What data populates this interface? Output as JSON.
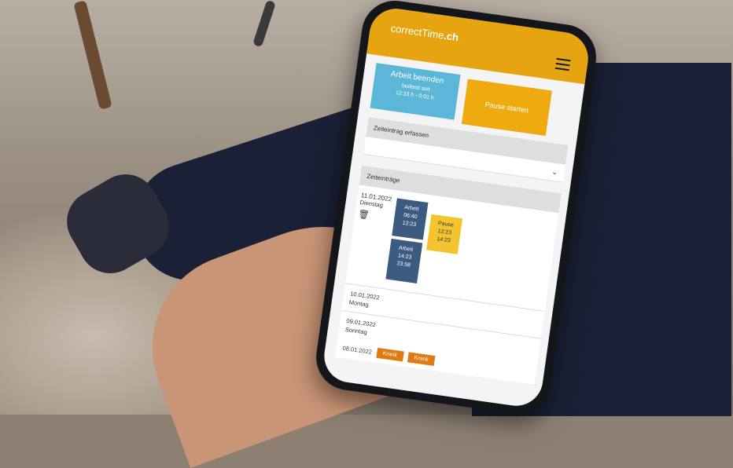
{
  "app": {
    "brand": "correctTime",
    "brand_suffix": ".ch"
  },
  "actions": {
    "work_end_title": "Arbeit beenden",
    "work_running": "laufend seit",
    "work_duration": "12:33 h - 0:01 h",
    "pause_start": "Pause starten"
  },
  "entry_form": {
    "label": "Zeiteintrag erfassen"
  },
  "entries": {
    "header": "Zeiteinträge",
    "day1": {
      "date": "11.01.2022",
      "weekday": "Dienstag",
      "blocks": [
        {
          "title": "Arbeit",
          "start": "06:40",
          "end": "12:23"
        },
        {
          "title": "Pause",
          "start": "12:23",
          "end": "14:23"
        },
        {
          "title": "Arbeit",
          "start": "14:23",
          "end": "23:58"
        }
      ]
    },
    "day2": {
      "date": "10.01.2022",
      "weekday": "Montag"
    },
    "day3": {
      "date": "09.01.2022",
      "weekday": "Sonntag"
    },
    "day4": {
      "date": "08.01.2022",
      "badge1": "Krank",
      "badge2": "Krank"
    }
  },
  "colors": {
    "accent": "#e5a410",
    "work_tile": "#5bb6d8",
    "work_block": "#3d5a80",
    "pause_block": "#f4c430",
    "sick_badge": "#e07a12"
  }
}
